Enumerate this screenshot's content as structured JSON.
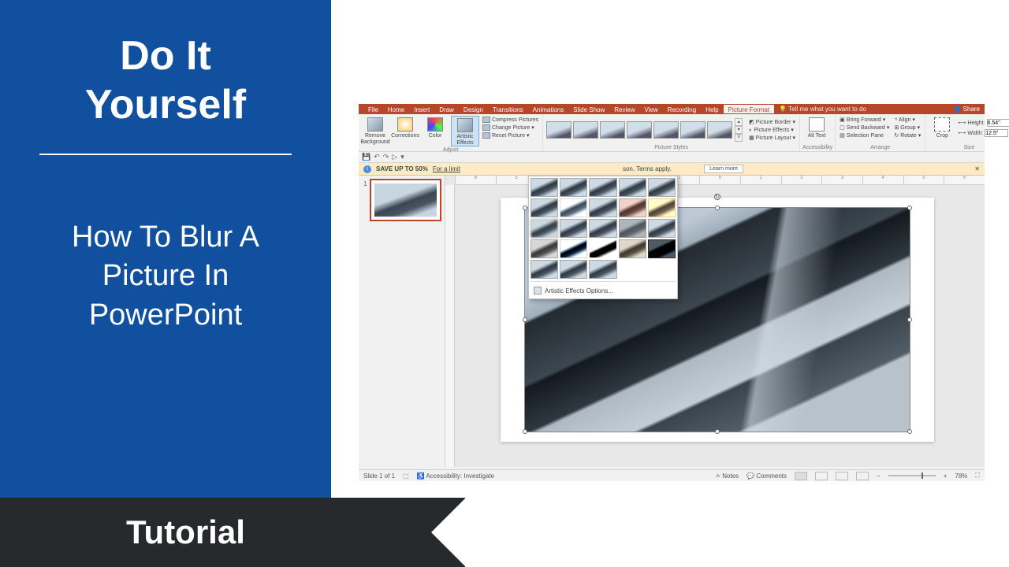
{
  "left_panel": {
    "title_line1": "Do It",
    "title_line2": "Yourself",
    "subtitle": "How To Blur A Picture In PowerPoint"
  },
  "banner": {
    "label": "Tutorial"
  },
  "app": {
    "tabs": [
      "File",
      "Home",
      "Insert",
      "Draw",
      "Design",
      "Transitions",
      "Animations",
      "Slide Show",
      "Review",
      "View",
      "Recording",
      "Help"
    ],
    "active_tab": "Picture Format",
    "tell_me": "Tell me what you want to do",
    "share": "Share",
    "ribbon": {
      "adjust": {
        "remove_bg": "Remove Background",
        "corrections": "Corrections",
        "color": "Color",
        "artistic": "Artistic Effects",
        "compress": "Compress Pictures",
        "change": "Change Picture",
        "reset": "Reset Picture",
        "label": "Adjust"
      },
      "styles": {
        "border": "Picture Border",
        "effects": "Picture Effects",
        "layout": "Picture Layout",
        "label": "Picture Styles"
      },
      "accessibility": {
        "alt_text": "Alt Text",
        "label": "Accessibility"
      },
      "arrange": {
        "bring_forward": "Bring Forward",
        "send_backward": "Send Backward",
        "selection_pane": "Selection Pane",
        "align": "Align",
        "group": "Group",
        "rotate": "Rotate",
        "label": "Arrange"
      },
      "size": {
        "crop": "Crop",
        "height": "6.54\"",
        "width": "12.5\"",
        "height_label": "Height:",
        "width_label": "Width:",
        "label": "Size"
      }
    },
    "artistic_options": "Artistic Effects Options...",
    "promo": {
      "bold": "SAVE UP TO 50%",
      "text": "For a limit",
      "tail": "son. Terms apply.",
      "learn": "Learn more"
    },
    "status": {
      "slide": "Slide 1 of 1",
      "accessibility": "Accessibility: Investigate",
      "notes": "Notes",
      "comments": "Comments",
      "zoom": "78%"
    },
    "ruler_h": [
      "6",
      "5",
      "4",
      "3",
      "2",
      "1",
      "0",
      "1",
      "2",
      "3",
      "4",
      "5",
      "6"
    ]
  }
}
